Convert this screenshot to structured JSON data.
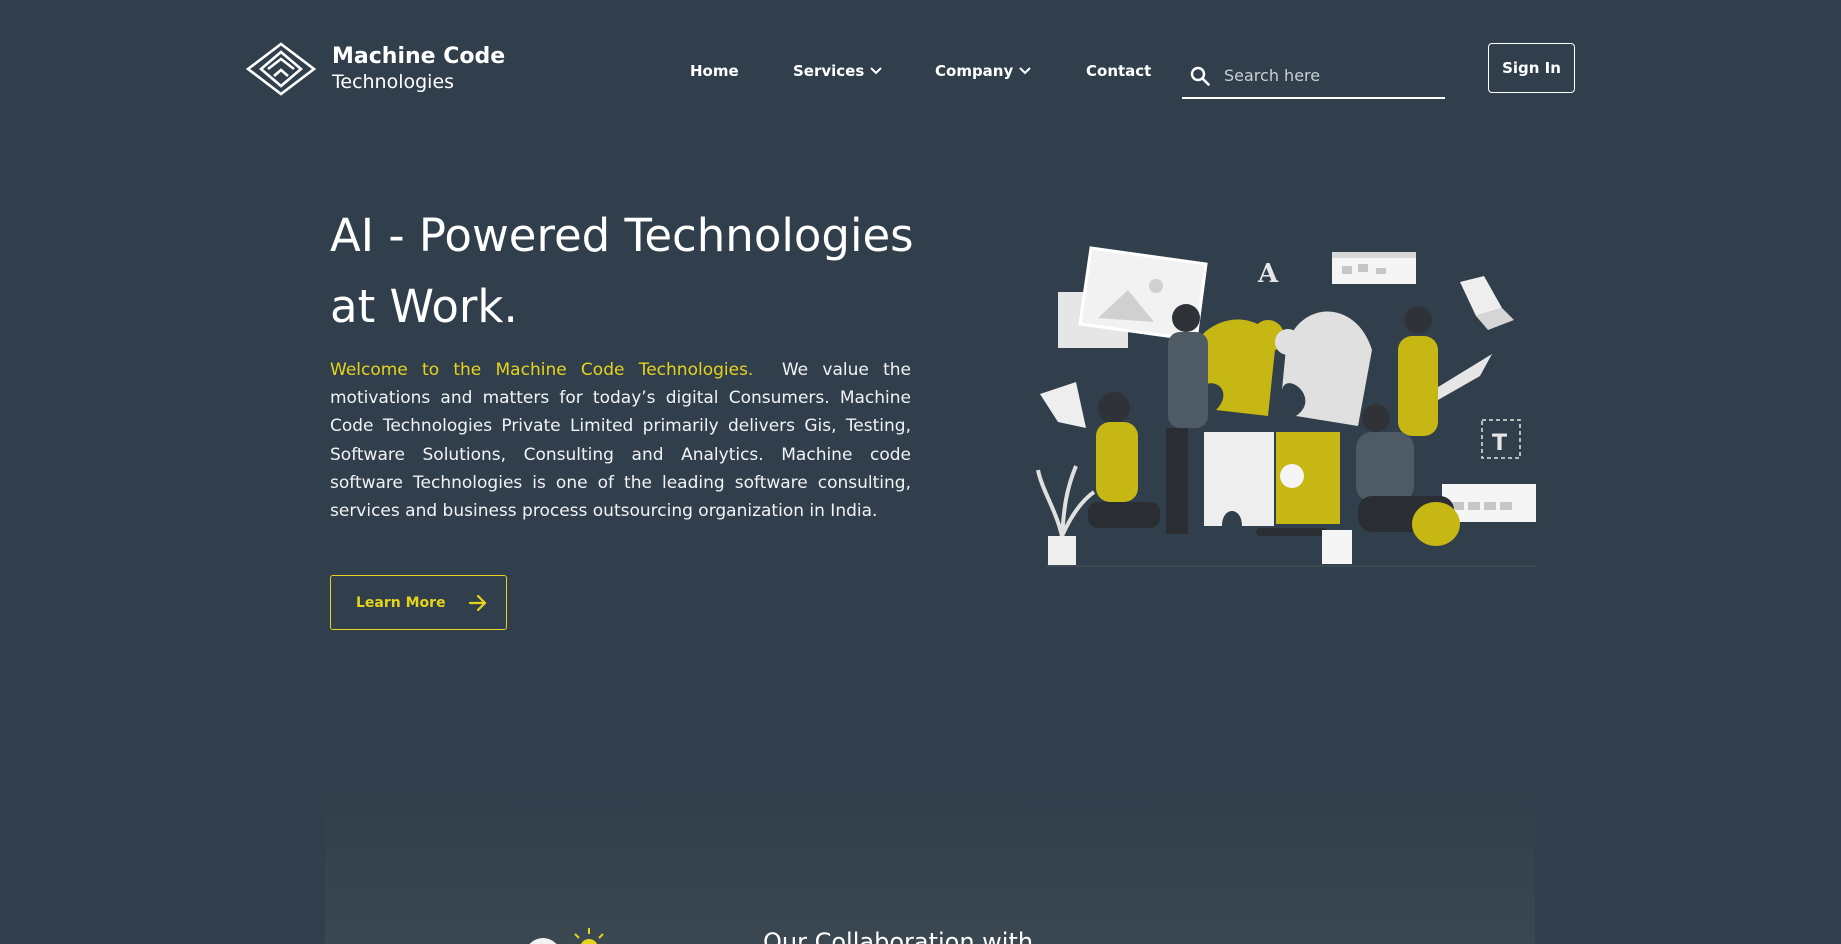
{
  "brand": {
    "name_line1": "Machine Code",
    "name_line2": "Technologies"
  },
  "nav": {
    "items": [
      {
        "label": "Home",
        "has_dropdown": false
      },
      {
        "label": "Services",
        "has_dropdown": true
      },
      {
        "label": "Company",
        "has_dropdown": true
      },
      {
        "label": "Contact",
        "has_dropdown": false
      }
    ]
  },
  "search": {
    "placeholder": "Search here",
    "value": ""
  },
  "header": {
    "signin_label": "Sign In"
  },
  "hero": {
    "title": "AI - Powered Technologies at Work.",
    "highlight": "Welcome to the Machine Code Technologies.",
    "body": "We value the motivations and matters for today’s digital Consumers. Machine Code Technologies Private Limited primarily delivers Gis, Testing, Software Solutions, Consulting and Analytics. Machine code software Technologies is one of the leading software consulting, services and business process outsourcing organization in India.",
    "cta_label": "Learn More"
  },
  "collab": {
    "title": "Our Collaboration with"
  },
  "colors": {
    "background": "#303f4b",
    "accent": "#e7d31c",
    "text": "#ffffff"
  }
}
